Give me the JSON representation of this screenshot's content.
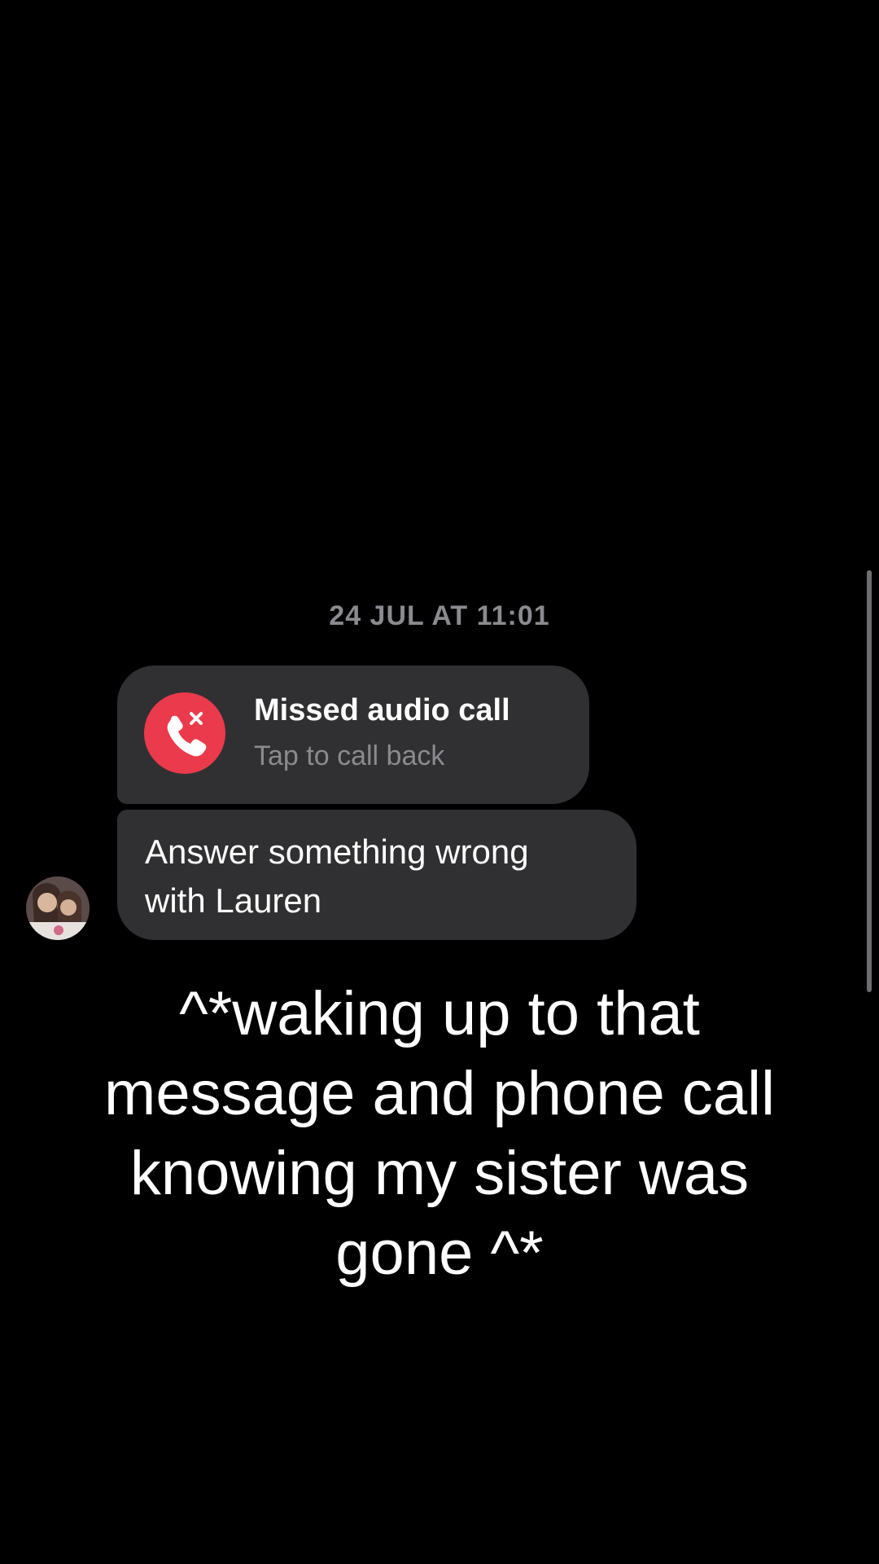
{
  "conversation": {
    "timestamp": "24 JUL AT 11:01",
    "missed_call": {
      "title": "Missed audio call",
      "subtitle": "Tap to call back",
      "icon": "missed-call-icon",
      "icon_color": "#ea3a4b"
    },
    "message": {
      "line1": "Answer something wrong",
      "line2": "with Lauren"
    }
  },
  "caption": {
    "line1": "^*waking up to that",
    "line2": "message and phone call",
    "line3": "knowing my sister was",
    "line4": "gone ^*"
  },
  "colors": {
    "background": "#000000",
    "bubble": "#303032",
    "muted_text": "#8a8a8f",
    "accent_red": "#ea3a4b"
  }
}
